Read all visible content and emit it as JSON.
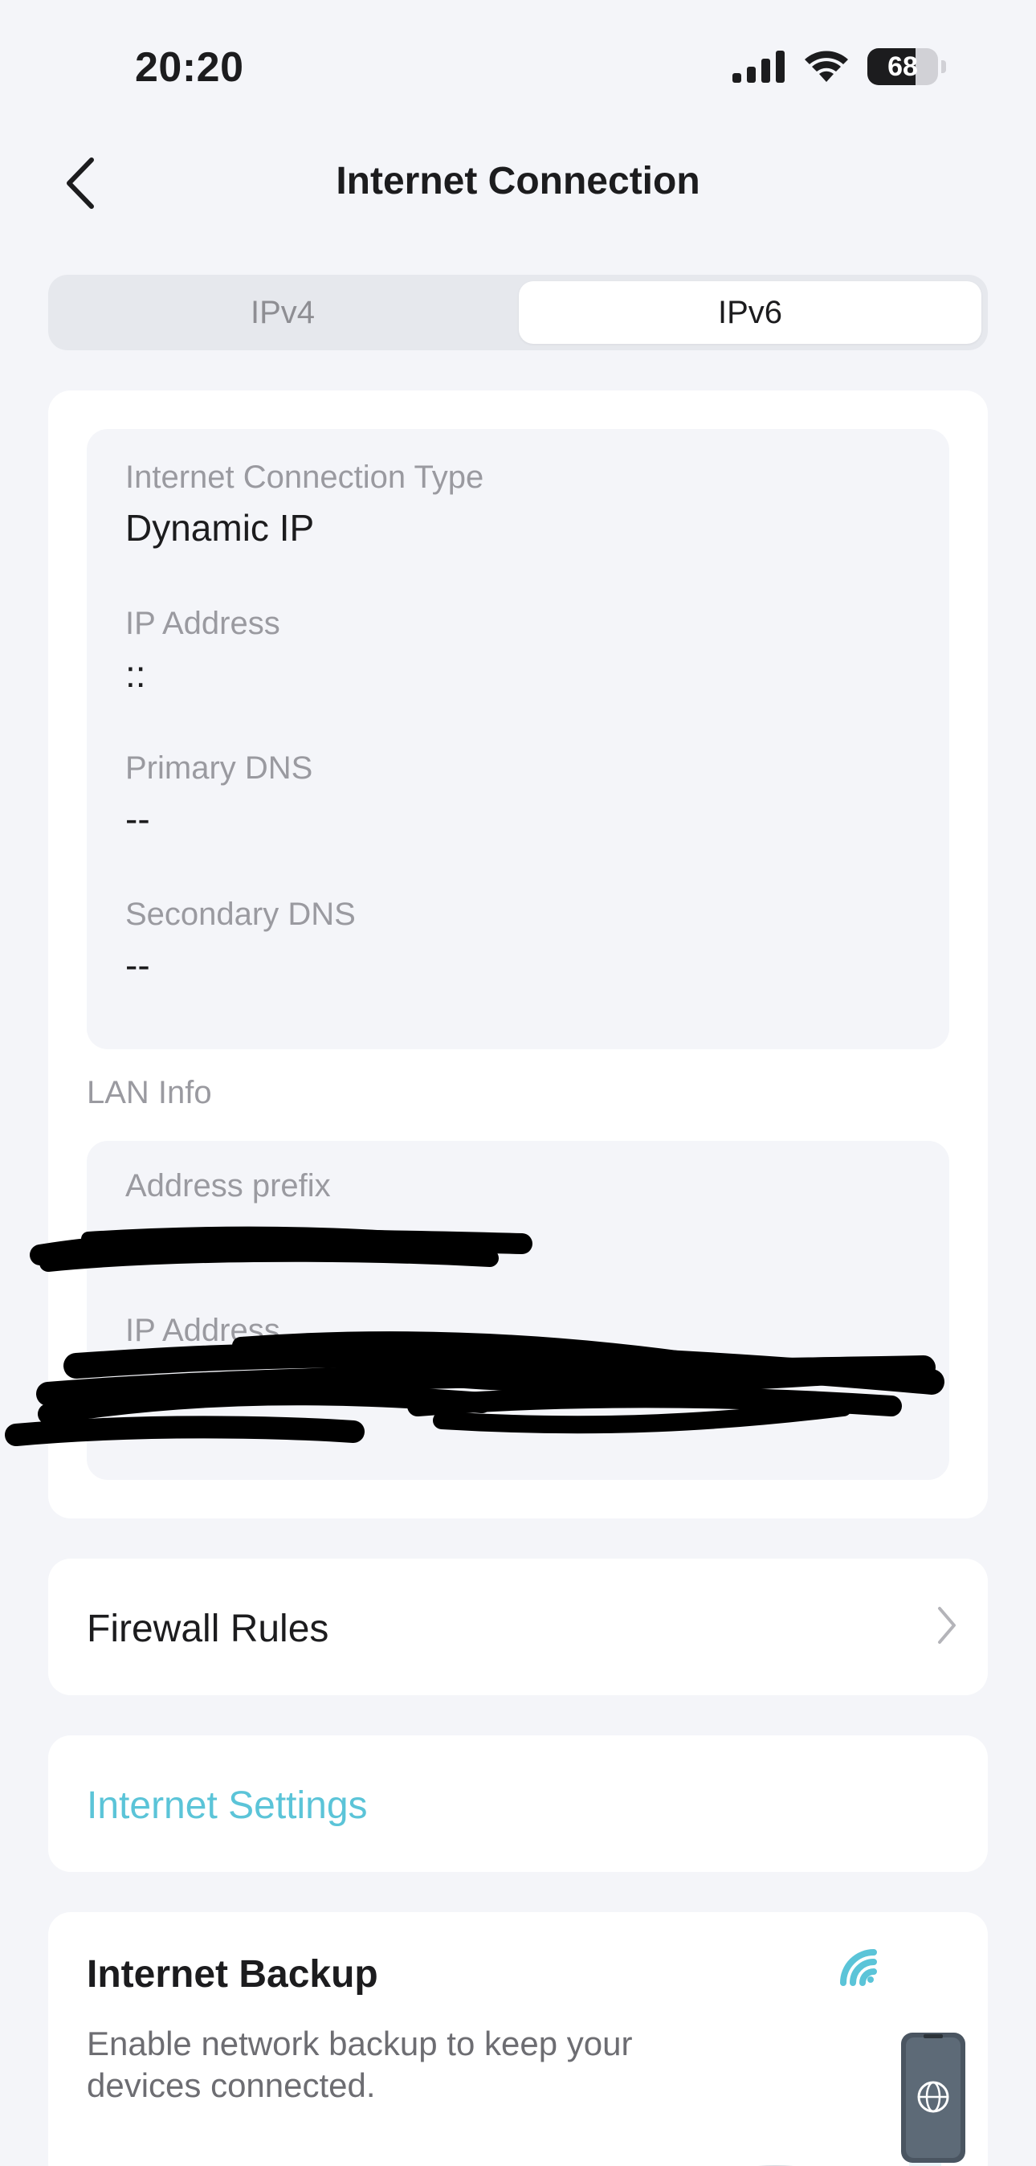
{
  "status_bar": {
    "time": "20:20",
    "battery_level": "68",
    "icons": [
      "cellular-signal-icon",
      "wifi-icon",
      "battery-icon"
    ]
  },
  "header": {
    "title": "Internet Connection",
    "back_icon": "chevron-left-icon"
  },
  "tabs": [
    {
      "label": "IPv4",
      "selected": false
    },
    {
      "label": "IPv6",
      "selected": true
    }
  ],
  "wan_info": {
    "connection_type": {
      "label": "Internet Connection Type",
      "value": "Dynamic IP"
    },
    "ip_address": {
      "label": "IP Address",
      "value": "::"
    },
    "primary_dns": {
      "label": "Primary DNS",
      "value": "--"
    },
    "secondary_dns": {
      "label": "Secondary DNS",
      "value": "--"
    }
  },
  "lan_info": {
    "section_title": "LAN Info",
    "address_prefix": {
      "label": "Address prefix",
      "value": "[redacted]"
    },
    "ip_address": {
      "label": "IP Address",
      "value": "[redacted]"
    }
  },
  "menu": {
    "firewall_rules": "Firewall Rules",
    "internet_settings": "Internet Settings"
  },
  "internet_backup": {
    "title": "Internet Backup",
    "description": "Enable network backup to keep your devices connected."
  },
  "colors": {
    "background": "#f4f5f9",
    "card": "#ffffff",
    "accent_link": "#5bc4d8",
    "secondary_text": "#9a9aa0"
  }
}
